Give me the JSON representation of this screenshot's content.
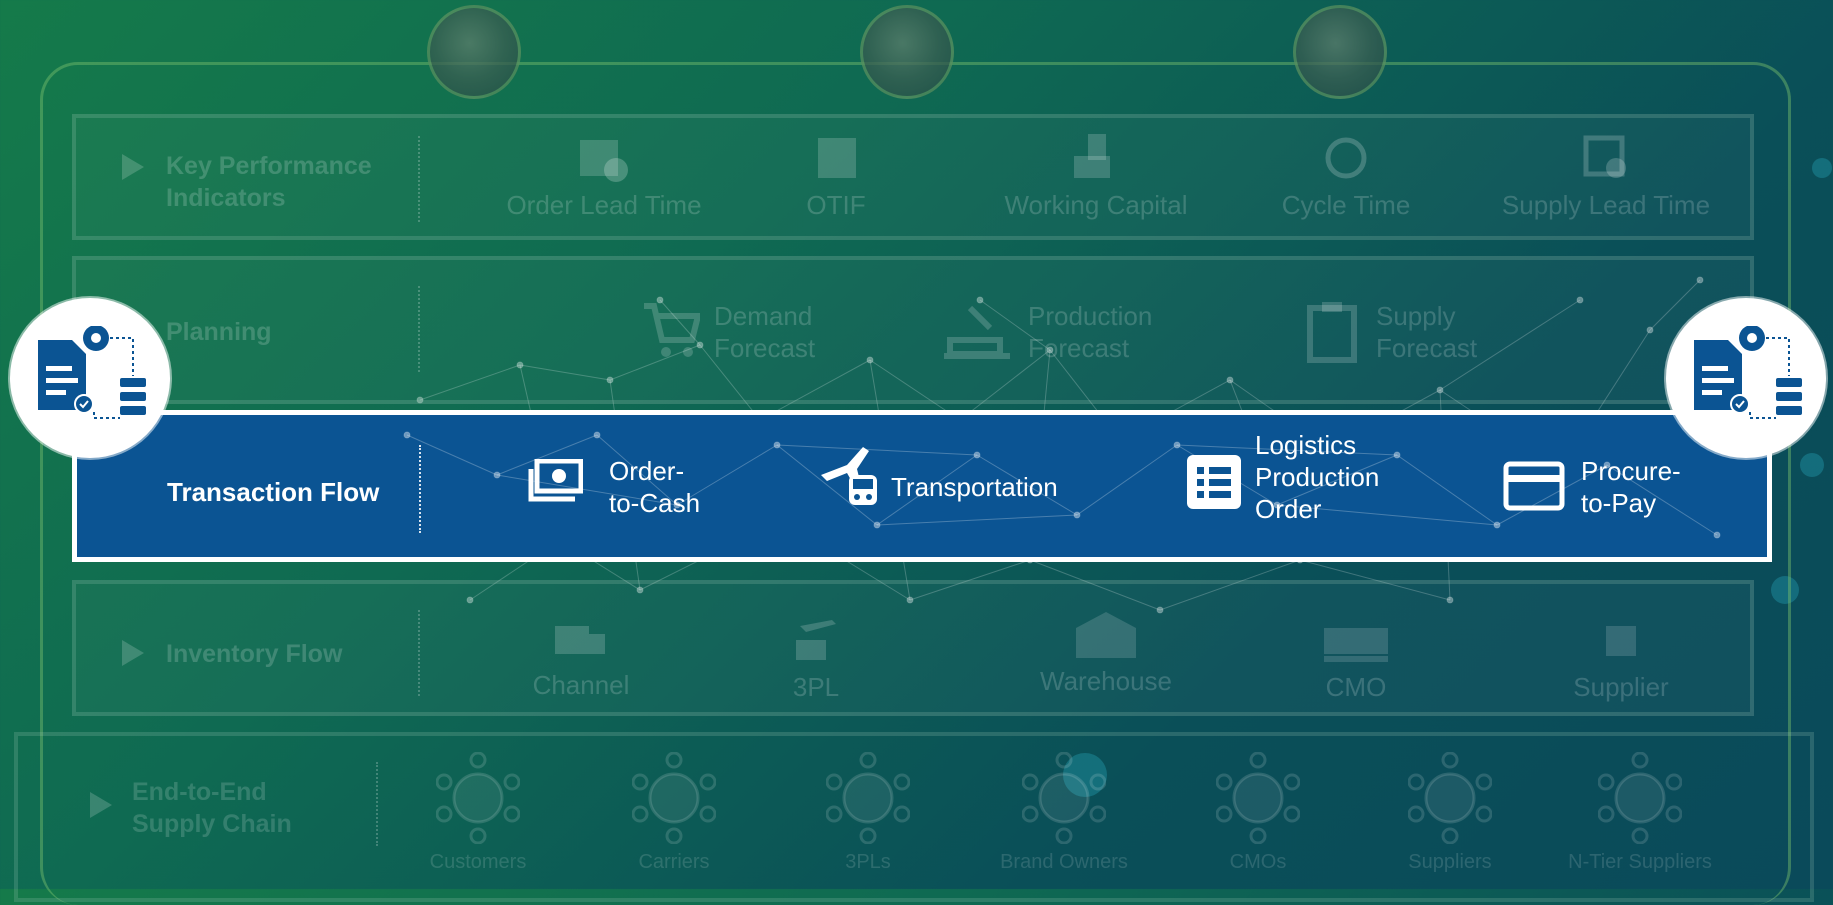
{
  "kpi": {
    "title": "Key Performance\nIndicators",
    "items": [
      {
        "label": "Order Lead Time",
        "icon": "box-clock-icon"
      },
      {
        "label": "OTIF",
        "icon": "package-icon"
      },
      {
        "label": "Working Capital",
        "icon": "cash-hand-icon"
      },
      {
        "label": "Cycle Time",
        "icon": "cycle-clock-icon"
      },
      {
        "label": "Supply Lead Time",
        "icon": "calendar-clock-icon"
      }
    ]
  },
  "planning": {
    "title": "Planning",
    "items": [
      {
        "label": "Demand\nForecast",
        "icon": "cart-icon"
      },
      {
        "label": "Production\nForecast",
        "icon": "factory-crane-icon"
      },
      {
        "label": "Supply\nForecast",
        "icon": "clipboard-icon"
      }
    ]
  },
  "transaction": {
    "title": "Transaction Flow",
    "items": [
      {
        "label": "Order-\nto-Cash",
        "icon": "money-stack-icon"
      },
      {
        "label": "Transportation",
        "icon": "plane-train-icon"
      },
      {
        "label": "Logistics\nProduction\nOrder",
        "icon": "list-icon"
      },
      {
        "label": "Procure-\nto-Pay",
        "icon": "credit-card-icon"
      }
    ]
  },
  "inventory": {
    "title": "Inventory Flow",
    "items": [
      {
        "label": "Channel",
        "icon": "truck-icon"
      },
      {
        "label": "3PL",
        "icon": "plane-truck-icon"
      },
      {
        "label": "Warehouse",
        "icon": "warehouse-icon"
      },
      {
        "label": "CMO",
        "icon": "factory-icon"
      },
      {
        "label": "Supplier",
        "icon": "chip-icon"
      }
    ]
  },
  "e2e": {
    "title": "End-to-End\nSupply Chain",
    "items": [
      {
        "label": "Customers",
        "icon": "building-network-icon"
      },
      {
        "label": "Carriers",
        "icon": "pin-network-icon"
      },
      {
        "label": "3PLs",
        "icon": "plane-network-icon"
      },
      {
        "label": "Brand Owners",
        "icon": "target-network-icon"
      },
      {
        "label": "CMOs",
        "icon": "factory-network-icon"
      },
      {
        "label": "Suppliers",
        "icon": "scale-network-icon"
      },
      {
        "label": "N-Tier Suppliers",
        "icon": "boxes-network-icon"
      }
    ]
  },
  "colors": {
    "band": "#0b5493",
    "background": "#0f6a52",
    "accent_green": "#78be6e"
  }
}
